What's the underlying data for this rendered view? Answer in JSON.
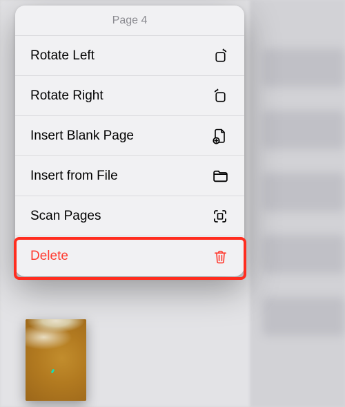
{
  "header": {
    "title": "Page 4"
  },
  "menu": {
    "items": [
      {
        "label": "Rotate Left",
        "icon": "rotate-left-icon",
        "destructive": false
      },
      {
        "label": "Rotate Right",
        "icon": "rotate-right-icon",
        "destructive": false
      },
      {
        "label": "Insert Blank Page",
        "icon": "insert-page-icon",
        "destructive": false
      },
      {
        "label": "Insert from File",
        "icon": "folder-icon",
        "destructive": false
      },
      {
        "label": "Scan Pages",
        "icon": "scan-icon",
        "destructive": false
      },
      {
        "label": "Delete",
        "icon": "trash-icon",
        "destructive": true
      }
    ]
  },
  "highlight": {
    "target_index": 5
  },
  "colors": {
    "destructive": "#ff3a2f",
    "highlight_border": "#ff2d1f"
  },
  "thumbnail": {
    "description": "beach-sand-waves"
  }
}
